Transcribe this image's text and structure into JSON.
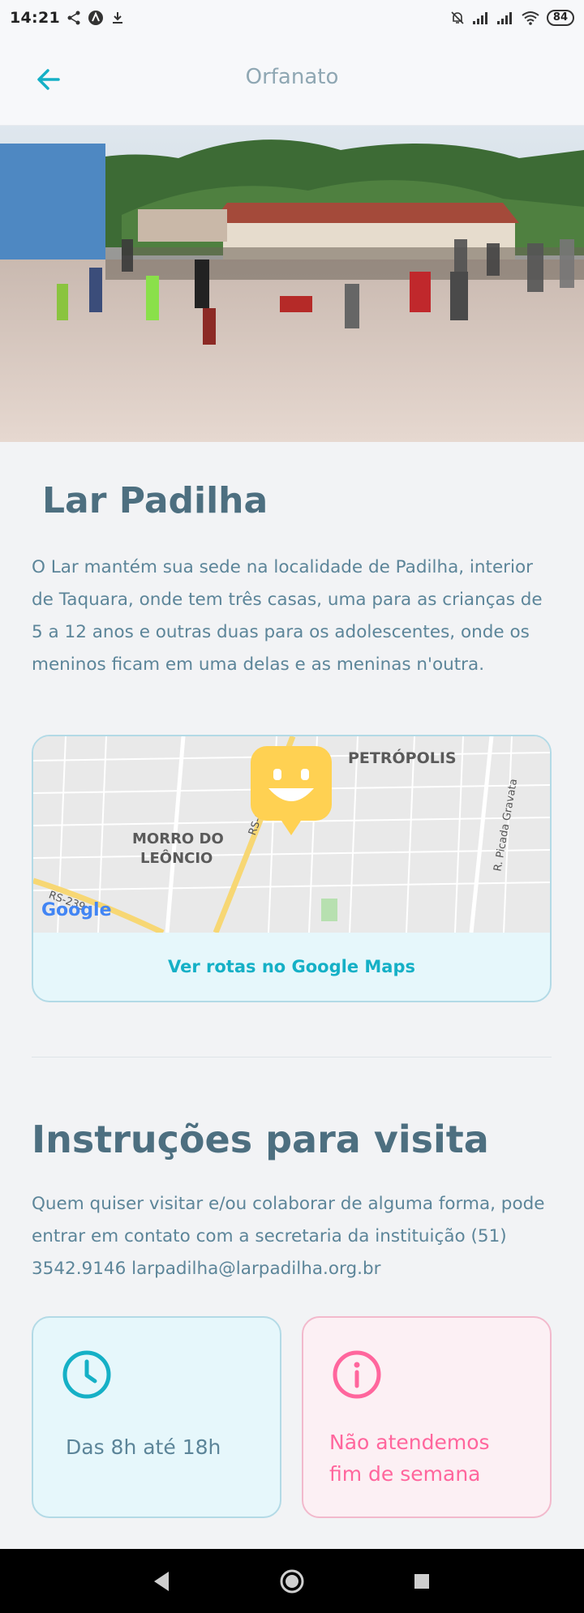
{
  "status_bar": {
    "time": "14:21",
    "battery": "84",
    "icons": [
      "share-icon",
      "app-icon",
      "download-icon",
      "mute-icon",
      "signal-icon",
      "signal-icon",
      "wifi-icon",
      "battery-icon"
    ]
  },
  "app_bar": {
    "title": "Orfanato",
    "back_icon": "arrow-left-icon"
  },
  "orphanage": {
    "name": "Lar Padilha",
    "about": " O Lar mantém sua sede na localidade de Padilha, interior de Taquara, onde tem três casas, uma para as crianças de 5 a 12 anos e outras duas para os adolescentes, onde os meninos ficam em uma delas e as meninas n'outra."
  },
  "map": {
    "labels": {
      "petropolis": "PETRÓPOLIS",
      "morro_line1": "MORRO DO",
      "morro_line2": "LEÔNCIO",
      "rs0": "RS-0",
      "rs239": "RS-239",
      "picada": "R. Picada Gravata",
      "google": "Google"
    },
    "link_label": "Ver rotas no Google Maps"
  },
  "visit": {
    "title": "Instruções para visita",
    "instructions": " Quem quiser visitar e/ou colaborar de alguma forma, pode entrar em contato com a secretaria da instituição (51) 3542.9146 larpadilha@larpadilha.org.br",
    "hours": "Das 8h até 18h",
    "weekend": "Não atendemos fim de semana"
  },
  "colors": {
    "primary": "#15b0c6",
    "text": "#4d6f80",
    "text_secondary": "#5c8599",
    "warning": "#ff669d",
    "marker": "#ffd152"
  }
}
